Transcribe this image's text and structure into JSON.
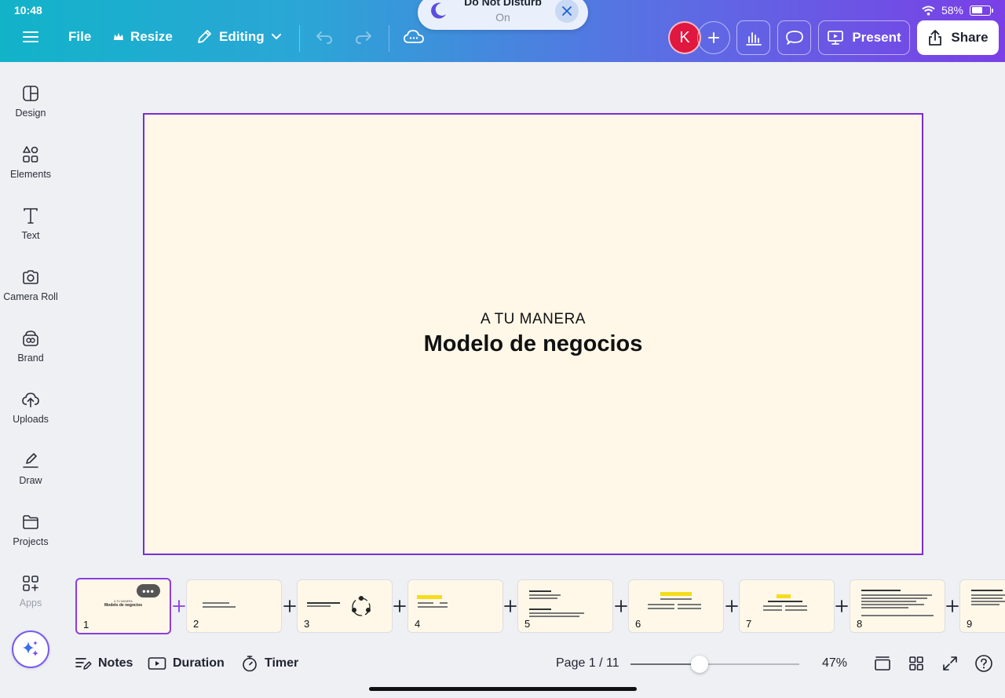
{
  "status": {
    "time": "10:48",
    "battery": "58%"
  },
  "topbar": {
    "file_label": "File",
    "resize_label": "Resize",
    "editing_label": "Editing",
    "present_label": "Present",
    "share_label": "Share",
    "avatar_initial": "K"
  },
  "dnd": {
    "title": "Do Not Disturb",
    "subtitle": "On"
  },
  "sidebar": {
    "items": [
      {
        "label": "Design",
        "icon": "design-icon"
      },
      {
        "label": "Elements",
        "icon": "elements-icon"
      },
      {
        "label": "Text",
        "icon": "text-icon"
      },
      {
        "label": "Camera Roll",
        "icon": "camera-icon"
      },
      {
        "label": "Brand",
        "icon": "brand-icon"
      },
      {
        "label": "Uploads",
        "icon": "upload-icon"
      },
      {
        "label": "Draw",
        "icon": "draw-icon"
      },
      {
        "label": "Projects",
        "icon": "folder-icon"
      },
      {
        "label": "Apps",
        "icon": "apps-icon"
      }
    ]
  },
  "canvas": {
    "kicker": "A TU MANERA",
    "title": "Modelo de negocios",
    "background": "#fff8e8",
    "selection_color": "#7b2cd6"
  },
  "filmstrip": {
    "pages": [
      "1",
      "2",
      "3",
      "4",
      "5",
      "6",
      "7",
      "8",
      "9"
    ],
    "active_page": "1"
  },
  "bottombar": {
    "notes_label": "Notes",
    "duration_label": "Duration",
    "timer_label": "Timer",
    "page_indicator": "Page 1 / 11",
    "zoom": "47%",
    "zoom_fraction": 0.41
  }
}
